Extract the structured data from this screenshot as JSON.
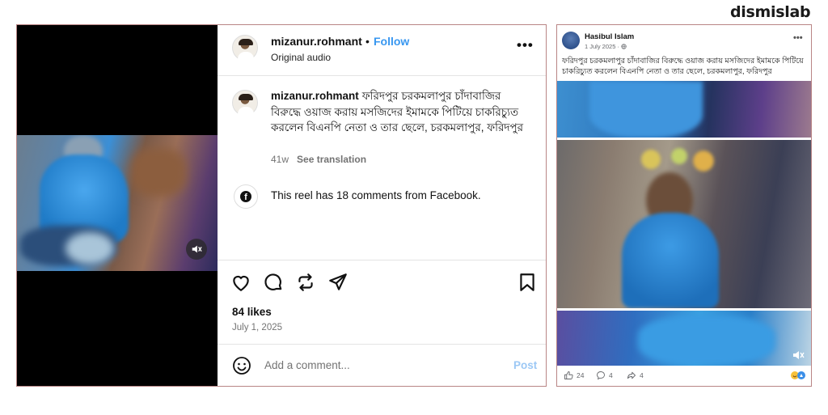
{
  "brand": {
    "name": "dismislab"
  },
  "instagram": {
    "username": "mizanur.rohmant",
    "dot": "•",
    "follow_label": "Follow",
    "audio_label": "Original audio",
    "more_label": "•••",
    "caption_user": "mizanur.rohmant",
    "caption_text": "ফরিদপুর চরকমলাপুর চাঁদাবাজির বিরুদ্ধে ওয়াজ করায় মসজিদের ইমামকে পিটিয়ে চাকরিচ্যুত করলেন বিএনপি নেতা ও তার ছেলে, চরকমলাপুর, ফরিদপুর",
    "caption_age": "41w",
    "translate_label": "See translation",
    "facebook_note": "This reel has 18 comments from Facebook.",
    "likes": "84 likes",
    "date": "July 1, 2025",
    "comment_placeholder": "Add a comment...",
    "post_label": "Post",
    "icons": [
      "heart-icon",
      "comment-icon",
      "repost-icon",
      "share-icon",
      "bookmark-icon",
      "emoji-icon",
      "muted-icon",
      "facebook-icon"
    ]
  },
  "facebook": {
    "author": "Hasibul Islam",
    "date": "1 July 2025 · ",
    "more_label": "•••",
    "caption": "ফরিদপুর চরকমলাপুর চাঁদাবাজির বিরুদ্ধে ওয়াজ করায় মসজিদের ইমামকে পিটিয়ে চাকরিচ্যুত করলেন বিএনপি নেতা ও তার ছেলে, চরকমলাপুর, ফরিদপুর",
    "likes": "24",
    "comments": "4",
    "shares": "4",
    "icons": [
      "like-icon",
      "comment-icon",
      "share-icon",
      "muted-icon",
      "globe-icon"
    ]
  },
  "colors": {
    "follow": "#3897f0",
    "post_disabled": "#9cc8f5",
    "frame_border": "#b98585"
  }
}
